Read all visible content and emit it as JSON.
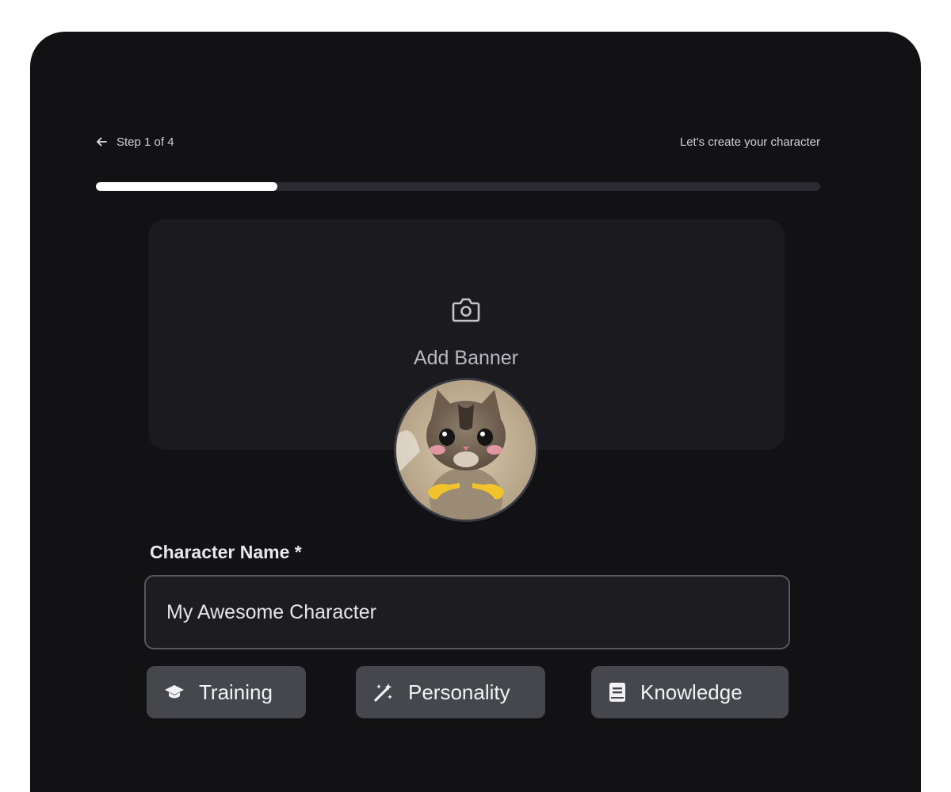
{
  "header": {
    "step_text": "Step 1 of 4",
    "subtitle": "Let's create your character",
    "back_icon": "arrow-left-icon",
    "progress_fraction": 0.25
  },
  "banner": {
    "label": "Add Banner",
    "icon": "camera-icon"
  },
  "avatar": {
    "description_icon": "kitten-avatar"
  },
  "form": {
    "name_label": "Character Name *",
    "name_value": "My Awesome Character"
  },
  "buttons": [
    {
      "label": "Training",
      "icon": "graduation-cap-icon"
    },
    {
      "label": "Personality",
      "icon": "magic-wand-icon"
    },
    {
      "label": "Knowledge",
      "icon": "book-icon"
    }
  ],
  "colors": {
    "background": "#121214",
    "progress_fill": "#ffffff",
    "progress_track": "#2b2b31",
    "chip": "#46464d"
  }
}
